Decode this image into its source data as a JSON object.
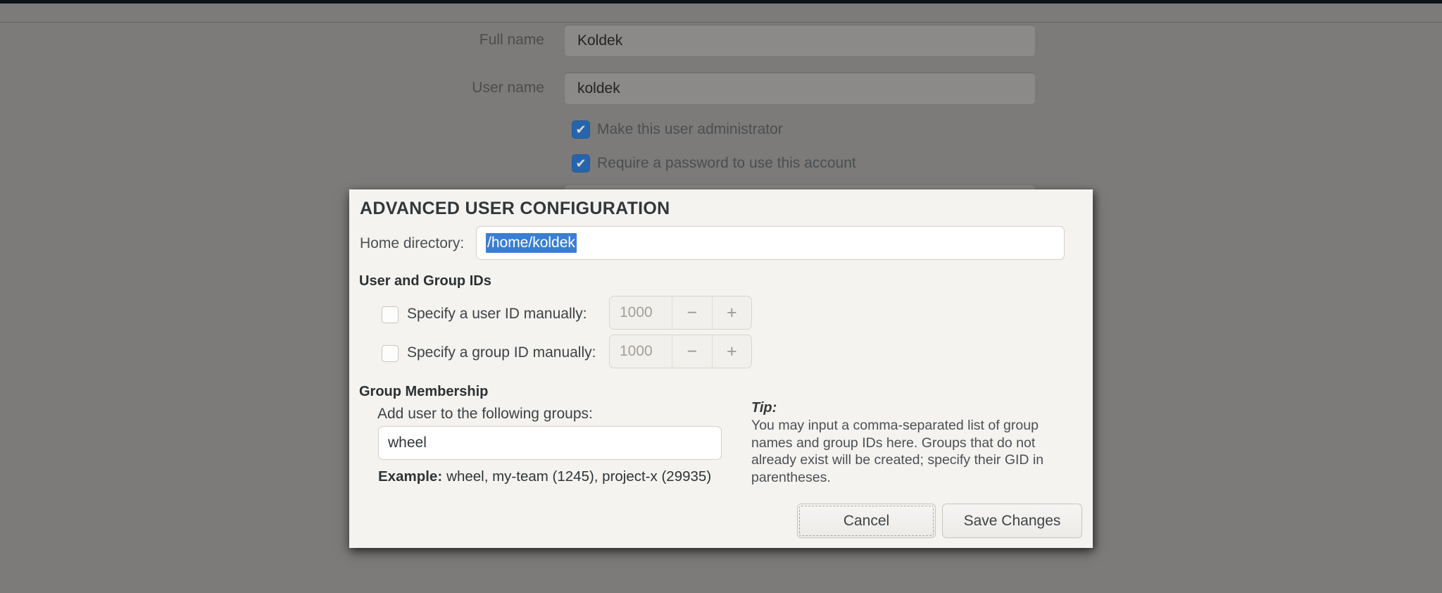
{
  "background_form": {
    "full_name": {
      "label": "Full name",
      "value": "Koldek"
    },
    "user_name": {
      "label": "User name",
      "value": "koldek"
    },
    "admin_checkbox": {
      "label": "Make this user administrator",
      "checked": true
    },
    "password_checkbox": {
      "label": "Require a password to use this account",
      "checked": true
    }
  },
  "dialog": {
    "title": "ADVANCED USER CONFIGURATION",
    "home_directory": {
      "label": "Home directory:",
      "value": "/home/koldek",
      "selected": true
    },
    "ids": {
      "header": "User and Group IDs",
      "rows": [
        {
          "label": "Specify a user ID manually:",
          "value": "1000",
          "checked": false,
          "enabled": false
        },
        {
          "label": "Specify a group ID manually:",
          "value": "1000",
          "checked": false,
          "enabled": false
        }
      ]
    },
    "groups": {
      "header": "Group Membership",
      "add_label": "Add user to the following groups:",
      "value": "wheel",
      "example_label": "Example:",
      "example_text": "wheel, my-team (1245), project-x (29935)"
    },
    "tip": {
      "title": "Tip:",
      "body": "You may input a comma-separated list of group names and group IDs here. Groups that do not already exist will be created; specify their GID in parentheses."
    },
    "buttons": {
      "cancel": "Cancel",
      "save": "Save Changes"
    }
  },
  "icons": {
    "check": "✔",
    "minus": "−",
    "plus": "+"
  },
  "colors": {
    "page_bg_dimmed": "#7c7b7a",
    "topbar": "#0e141b",
    "dialog_bg": "#f4f3f0",
    "selection_blue": "#3a7ed1",
    "checkbox_blue": "#2765ab"
  }
}
